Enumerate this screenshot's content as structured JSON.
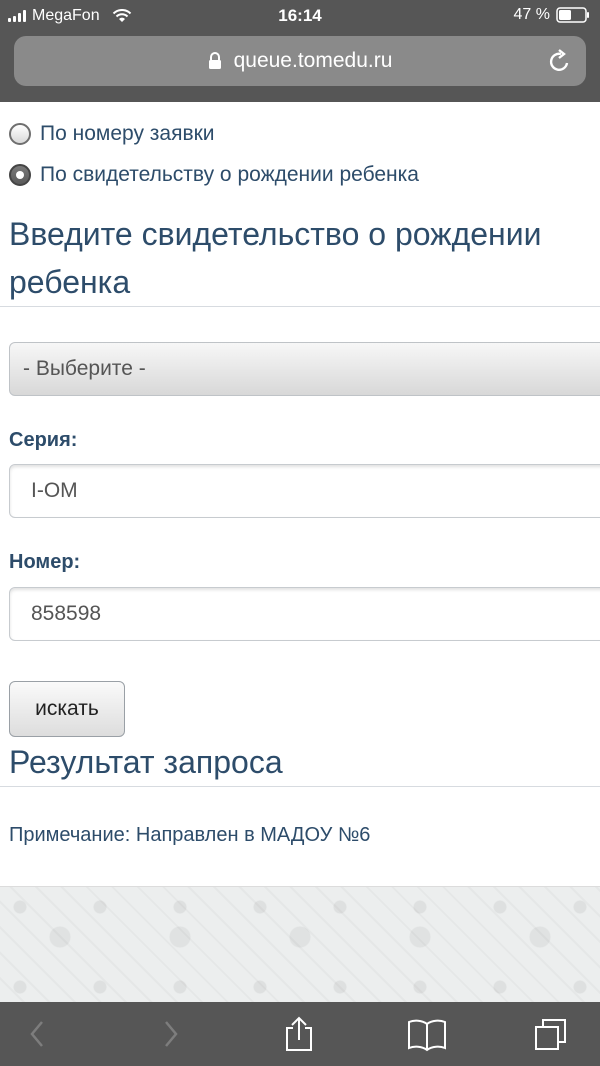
{
  "status_bar": {
    "carrier": "MegaFon",
    "time": "16:14",
    "battery": "47 %"
  },
  "browser": {
    "url": "queue.tomedu.ru"
  },
  "search_mode": {
    "options": [
      {
        "label": "По номеру заявки",
        "checked": false
      },
      {
        "label": "По свидетельству о рождении ребенка",
        "checked": true
      }
    ]
  },
  "form": {
    "title": "Введите свидетельство о рождении ребенка",
    "select_value": "- Выберите -",
    "series_label": "Серия:",
    "series_value": "I-OM",
    "number_label": "Номер:",
    "number_value": "858598",
    "submit_label": "искать"
  },
  "result": {
    "title": "Результат запроса",
    "note": "Примечание: Направлен в МАДОУ №6"
  },
  "toolbar": {
    "icons": [
      "back-icon",
      "forward-icon",
      "share-icon",
      "bookmarks-icon",
      "tabs-icon"
    ]
  },
  "colors": {
    "accent_text": "#2d4c6a",
    "chrome": "#565656"
  }
}
